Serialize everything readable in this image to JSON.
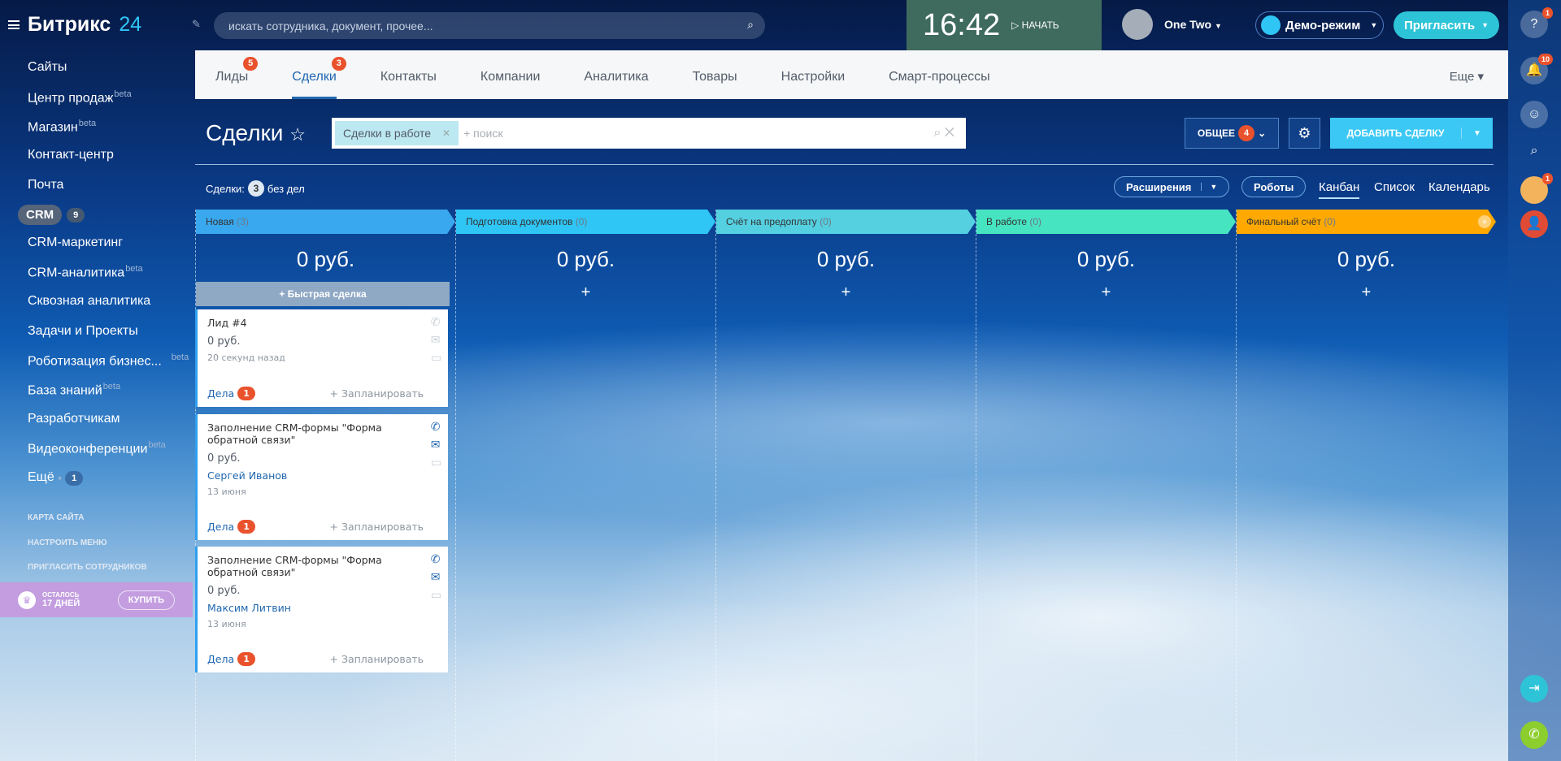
{
  "app": {
    "logo": "Битрикс",
    "logo_num": "24"
  },
  "search": {
    "placeholder": "искать сотрудника, документ, прочее..."
  },
  "clock": {
    "time": "16:42",
    "start": "НАЧАТЬ"
  },
  "user": {
    "name": "One Two"
  },
  "demo": {
    "label": "Демо-режим"
  },
  "invite": {
    "label": "Пригласить"
  },
  "sidebar": {
    "items": [
      {
        "label": "Сайты"
      },
      {
        "label": "Центр продаж",
        "beta": "beta"
      },
      {
        "label": "Магазин",
        "beta": "beta"
      },
      {
        "label": "Контакт-центр"
      },
      {
        "label": "Почта"
      },
      {
        "label": "CRM",
        "count": "9"
      },
      {
        "label": "CRM-маркетинг"
      },
      {
        "label": "CRM-аналитика",
        "beta": "beta"
      },
      {
        "label": "Сквозная аналитика"
      },
      {
        "label": "Задачи и Проекты"
      },
      {
        "label": "Роботизация бизнес...",
        "beta": "beta"
      },
      {
        "label": "База знаний",
        "beta": "beta"
      },
      {
        "label": "Разработчикам"
      },
      {
        "label": "Видеоконференции",
        "beta": "beta"
      },
      {
        "label": "Ещё",
        "count": "1"
      }
    ],
    "links": [
      "КАРТА САЙТА",
      "НАСТРОИТЬ МЕНЮ",
      "ПРИГЛАСИТЬ СОТРУДНИКОВ"
    ],
    "promo": {
      "line1": "ОСТАЛОСЬ",
      "line2": "17 ДНЕЙ",
      "button": "КУПИТЬ"
    }
  },
  "tabs": [
    {
      "label": "Лиды",
      "badge": "5"
    },
    {
      "label": "Сделки",
      "badge": "3",
      "active": true
    },
    {
      "label": "Контакты"
    },
    {
      "label": "Компании"
    },
    {
      "label": "Аналитика"
    },
    {
      "label": "Товары"
    },
    {
      "label": "Настройки"
    },
    {
      "label": "Смарт-процессы"
    }
  ],
  "tabs_more": "Еще",
  "right_panel": {
    "help_badge": "1",
    "notif_badge": "10",
    "avatar_badge": "1"
  },
  "page": {
    "title": "Сделки",
    "filter_chip": "Сделки в работе",
    "filter_placeholder": "+ поиск",
    "general": "ОБЩЕЕ",
    "general_count": "4",
    "add_deal": "ДОБАВИТЬ СДЕЛКУ",
    "stat_label": "Сделки:",
    "stat_count": "3",
    "stat_suffix": "без дел",
    "extensions": "Расширения",
    "robots": "Роботы",
    "views": [
      "Канбан",
      "Список",
      "Календарь"
    ]
  },
  "columns": [
    {
      "title": "Новая",
      "count": "(3)",
      "sum": "0 руб.",
      "color": "#39a8ef"
    },
    {
      "title": "Подготовка документов",
      "count": "(0)",
      "sum": "0 руб.",
      "color": "#2fc6f6"
    },
    {
      "title": "Счёт на предоплату",
      "count": "(0)",
      "sum": "0 руб.",
      "color": "#55d0e0"
    },
    {
      "title": "В работе",
      "count": "(0)",
      "sum": "0 руб.",
      "color": "#47e4c2"
    },
    {
      "title": "Финальный счёт",
      "count": "(0)",
      "sum": "0 руб.",
      "color": "#ffa900"
    }
  ],
  "quick_deal": "Быстрая сделка",
  "cards": [
    {
      "title": "Лид #4",
      "price": "0 руб.",
      "person": "",
      "date": "20 секунд назад",
      "tasks": "Дела",
      "tasks_count": "1",
      "plan": "+ Запланировать"
    },
    {
      "title": "Заполнение CRM-формы \"Форма обратной связи\"",
      "price": "0 руб.",
      "person": "Сергей Иванов",
      "date": "13 июня",
      "tasks": "Дела",
      "tasks_count": "1",
      "plan": "+ Запланировать"
    },
    {
      "title": "Заполнение CRM-формы \"Форма обратной связи\"",
      "price": "0 руб.",
      "person": "Максим Литвин",
      "date": "13 июня",
      "tasks": "Дела",
      "tasks_count": "1",
      "plan": "+ Запланировать"
    }
  ]
}
